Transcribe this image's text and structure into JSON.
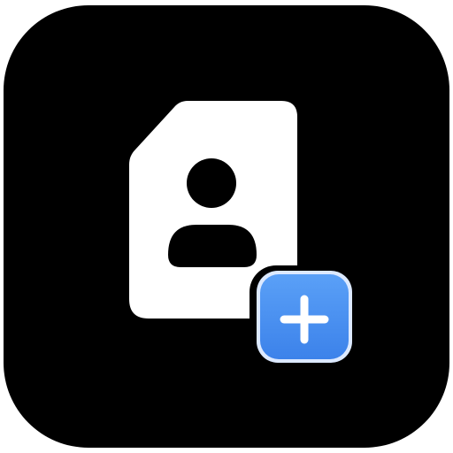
{
  "icon": {
    "name": "add-contact-card-app-icon",
    "background_color": "#000000",
    "card_color": "#ffffff",
    "person_color": "#000000",
    "badge_color": "#4a90f2",
    "badge_border_color": "#dce9ff",
    "plus_color": "#ffffff"
  }
}
